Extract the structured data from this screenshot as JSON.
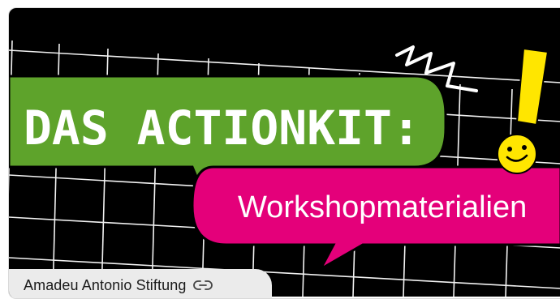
{
  "hero": {
    "headline": "DAS ACTIONKIT:",
    "subline": "Workshopmaterialien",
    "colors": {
      "background": "#000000",
      "grid": "#ffffff",
      "green_bubble": "#5ea32b",
      "pink_bubble": "#e4007a",
      "accent_yellow": "#ffe600"
    }
  },
  "source": {
    "label": "Amadeu Antonio Stiftung",
    "icon": "link-icon"
  }
}
